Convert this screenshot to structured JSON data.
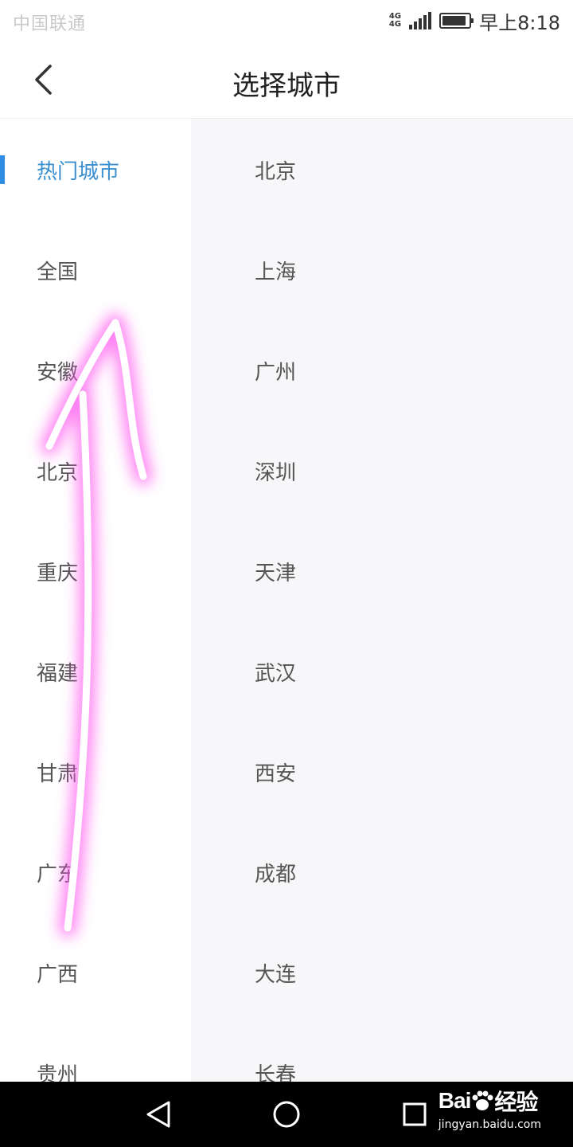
{
  "status_bar": {
    "carrier": "中国联通",
    "network_top": "4G",
    "network_bottom": "4G",
    "battery_level": 0.9,
    "clock": "早上8:18"
  },
  "header": {
    "back_icon": "chevron-left-icon",
    "title": "选择城市"
  },
  "provinces": [
    {
      "label": "热门城市",
      "active": true
    },
    {
      "label": "全国"
    },
    {
      "label": "安徽"
    },
    {
      "label": "北京"
    },
    {
      "label": "重庆"
    },
    {
      "label": "福建"
    },
    {
      "label": "甘肃"
    },
    {
      "label": "广东"
    },
    {
      "label": "广西"
    },
    {
      "label": "贵州"
    }
  ],
  "cities": [
    {
      "label": "北京"
    },
    {
      "label": "上海"
    },
    {
      "label": "广州"
    },
    {
      "label": "深圳"
    },
    {
      "label": "天津"
    },
    {
      "label": "武汉"
    },
    {
      "label": "西安"
    },
    {
      "label": "成都"
    },
    {
      "label": "大连"
    },
    {
      "label": "长春"
    }
  ],
  "nav_bar": {
    "back_icon": "triangle-back-icon",
    "home_icon": "circle-home-icon",
    "recents_icon": "square-recents-icon"
  },
  "watermark": {
    "logo_prefix": "Bai",
    "logo_suffix": "经验",
    "url": "jingyan.baidu.com"
  },
  "colors": {
    "accent": "#3a8fd0",
    "annotation_glow": "#ff55ee"
  }
}
